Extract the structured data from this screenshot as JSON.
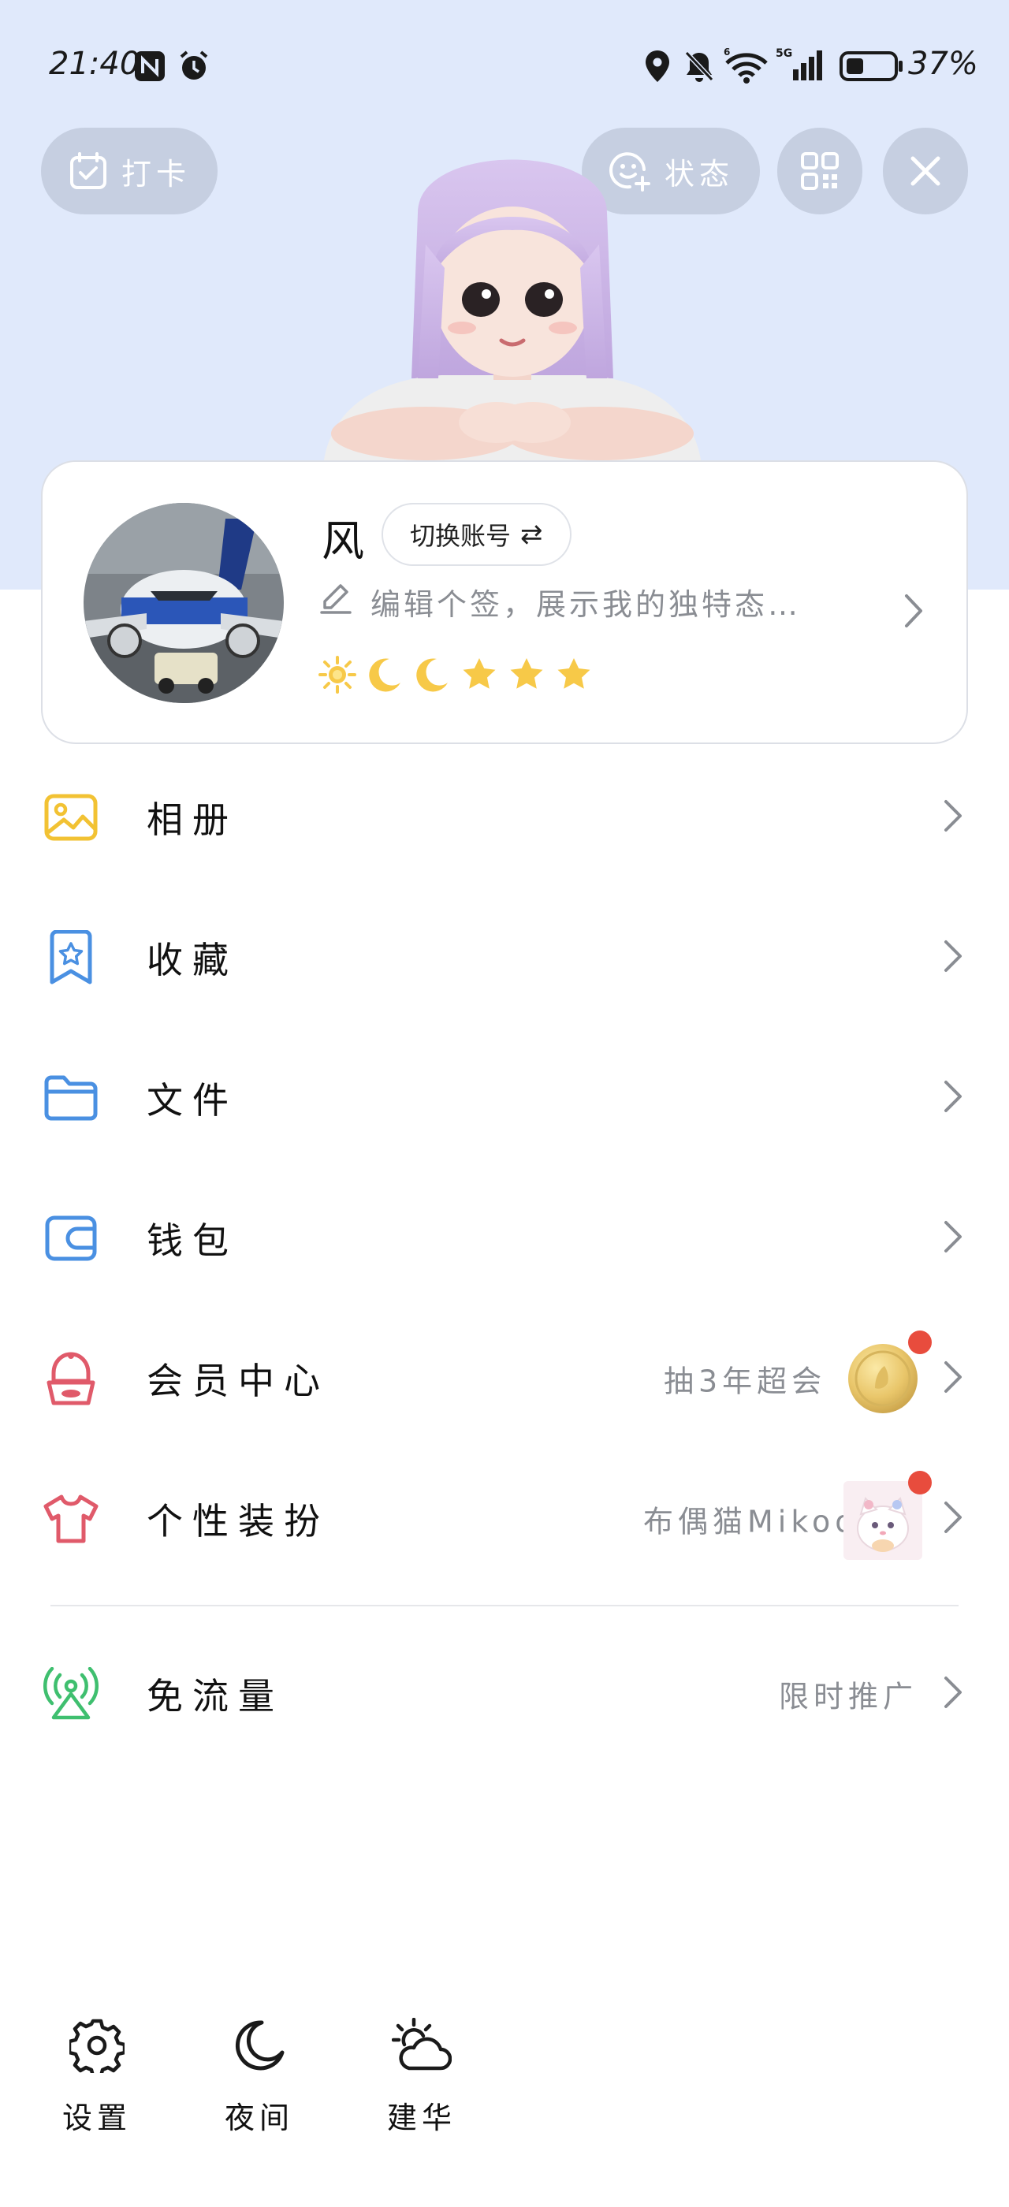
{
  "status_bar": {
    "time": "21:40",
    "battery_percent": "37%",
    "battery_level": 0.37,
    "network": "5G"
  },
  "top_actions": {
    "checkin_label": "打卡",
    "status_label": "状态"
  },
  "profile": {
    "nickname": "风",
    "switch_account_label": "切换账号",
    "switch_account_icon": "⇄",
    "signature_placeholder": "编辑个签，展示我的独特态…",
    "level_badges": [
      "sun",
      "moon",
      "moon",
      "star",
      "star",
      "star"
    ]
  },
  "menu": {
    "album": {
      "label": "相册"
    },
    "favorites": {
      "label": "收藏"
    },
    "files": {
      "label": "文件"
    },
    "wallet": {
      "label": "钱包"
    },
    "vip": {
      "label": "会员中心",
      "promo": "抽3年超会"
    },
    "personalize": {
      "label": "个性装扮",
      "promo": "布偶猫Mikoo"
    },
    "free_data": {
      "label": "免流量",
      "promo": "限时推广"
    }
  },
  "bottom_nav": {
    "settings_label": "设置",
    "night_label": "夜间",
    "weather_label": "建华"
  },
  "colors": {
    "header_bg": "#e0e9fb",
    "album_icon": "#f2c233",
    "blue_icon": "#4a90e2",
    "vip_icon": "#e05a6a",
    "free_data_icon": "#3fbf6f",
    "badge_gold": "#f7c948",
    "notification_dot": "#e84c3d"
  }
}
